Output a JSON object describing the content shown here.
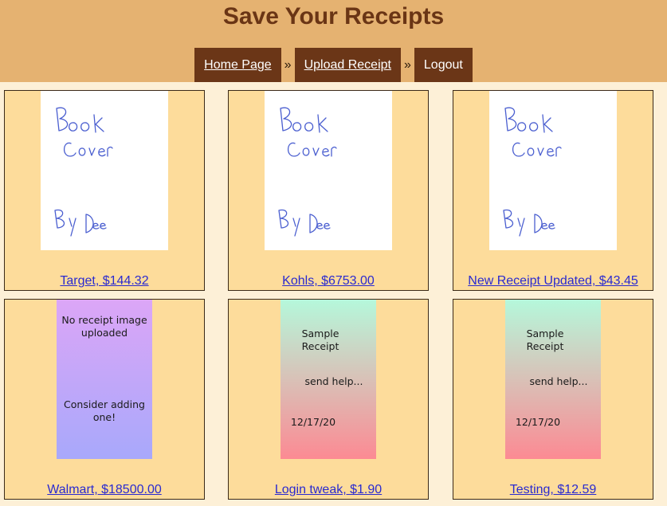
{
  "header": {
    "title": "Save Your Receipts",
    "nav": {
      "home": "Home Page",
      "upload": "Upload Receipt",
      "logout": "Logout",
      "separator": "»"
    }
  },
  "receipts": [
    {
      "caption": "Target, $144.32",
      "image": "book-cover"
    },
    {
      "caption": "Kohls, $6753.00",
      "image": "book-cover"
    },
    {
      "caption": "New Receipt Updated, $43.45",
      "image": "book-cover"
    },
    {
      "caption": "Walmart, $18500.00",
      "image": "no-receipt-placeholder"
    },
    {
      "caption": "Login tweak, $1.90",
      "image": "sample-receipt"
    },
    {
      "caption": "Testing, $12.59",
      "image": "sample-receipt"
    }
  ],
  "images": {
    "book_cover": {
      "line1": "Book",
      "line2": "Cover",
      "line3": "By Dee"
    },
    "placeholder": {
      "line1": "No receipt image uploaded",
      "line2": "Consider adding one!"
    },
    "sample": {
      "line1": "Sample Receipt",
      "line2": "send help...",
      "line3": "12/17/20"
    }
  },
  "colors": {
    "header_bg": "#e5b271",
    "title": "#6a3515",
    "nav_bg": "#6b3617",
    "card_bg": "#fddc9b",
    "page_bg": "#fdf0d7",
    "link": "#2a2ad0"
  }
}
